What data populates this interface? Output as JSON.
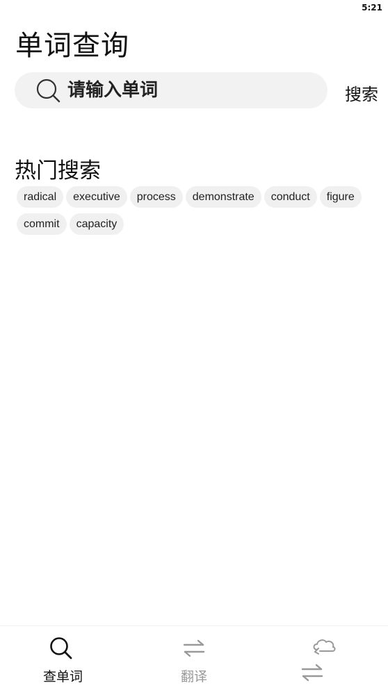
{
  "status_bar": {
    "time": "5:21"
  },
  "page": {
    "title": "单词查询"
  },
  "search": {
    "placeholder": "请输入单词",
    "button_label": "搜索"
  },
  "hot_search": {
    "title": "热门搜索",
    "tags": [
      "radical",
      "executive",
      "process",
      "demonstrate",
      "conduct",
      "figure",
      "commit",
      "capacity"
    ]
  },
  "bottom_nav": {
    "items": [
      {
        "label": "查单词",
        "icon": "search-icon",
        "active": true
      },
      {
        "label": "翻译",
        "icon": "swap-arrows-icon",
        "active": false
      },
      {
        "label": "",
        "icon": "cloud-icon",
        "active": false
      }
    ]
  },
  "colors": {
    "active": "#111111",
    "inactive": "#999999",
    "search_bg": "#f2f2f2",
    "tag_bg": "#f0f0f0"
  }
}
